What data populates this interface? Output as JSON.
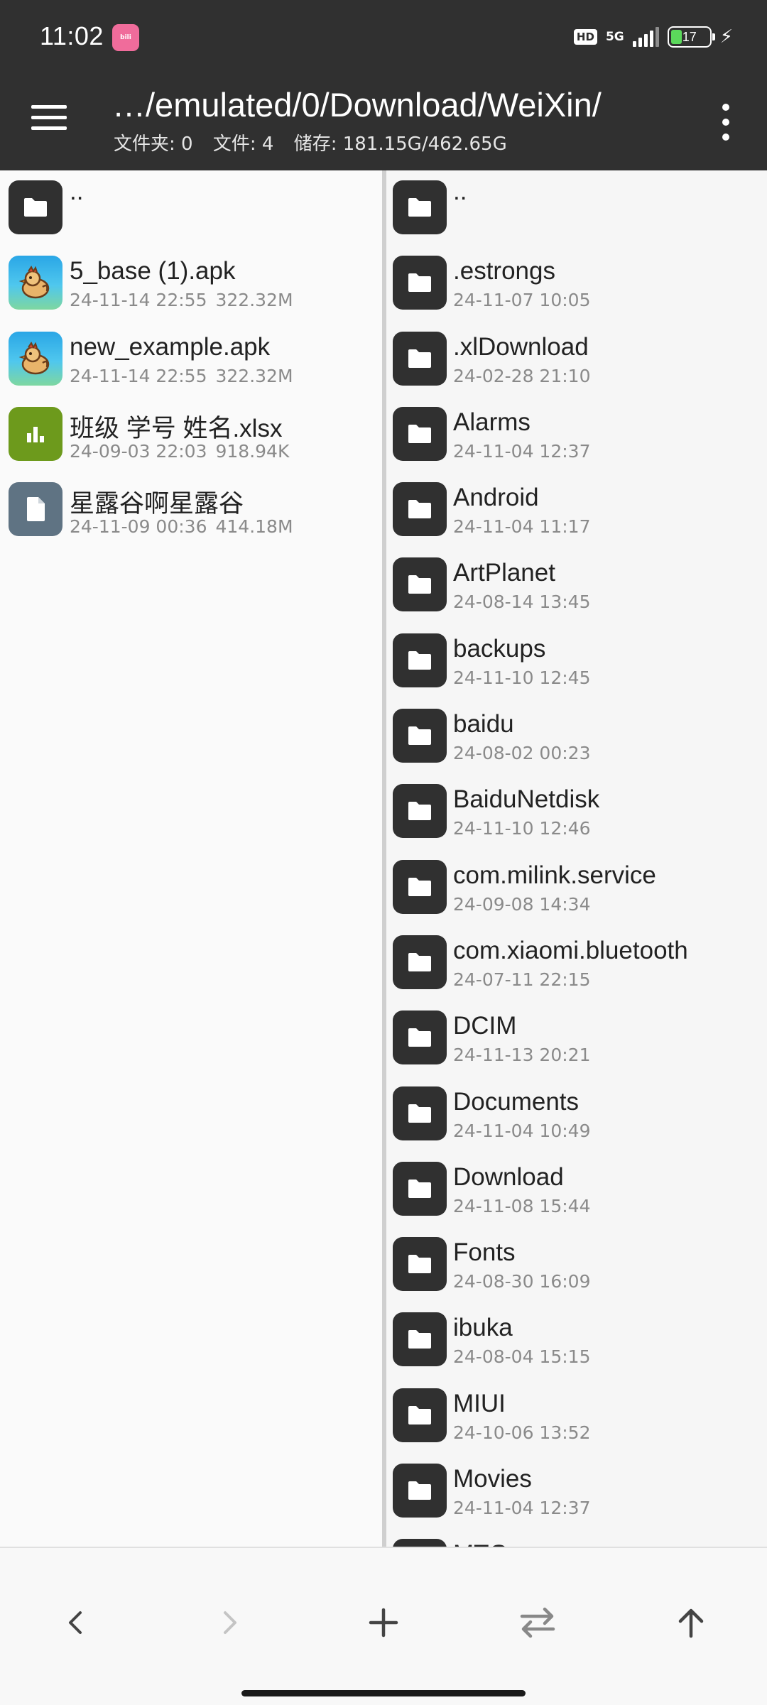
{
  "status_bar": {
    "time": "11:02",
    "notification_app": "bilibili",
    "hd_badge": "HD",
    "network": "5G",
    "battery_level": "17",
    "charging": true
  },
  "toolbar": {
    "path": "…/emulated/0/Download/WeiXin/",
    "folders_label": "文件夹: 0",
    "files_label": "文件: 4",
    "storage_label": "储存: 181.15G/462.65G"
  },
  "left_pane": {
    "items": [
      {
        "name": "..",
        "date": "",
        "size": "",
        "icon": "folder-icon"
      },
      {
        "name": "5_base (1).apk",
        "date": "24-11-14 22:55",
        "size": "322.32M",
        "icon": "apk-icon"
      },
      {
        "name": "new_example.apk",
        "date": "24-11-14 22:55",
        "size": "322.32M",
        "icon": "apk-icon"
      },
      {
        "name": "班级 学号 姓名.xlsx",
        "date": "24-09-03 22:03",
        "size": "918.94K",
        "icon": "spreadsheet-icon"
      },
      {
        "name": "星露谷啊星露谷",
        "date": "24-11-09 00:36",
        "size": "414.18M",
        "icon": "file-icon"
      }
    ]
  },
  "right_pane": {
    "items": [
      {
        "name": "..",
        "date": ""
      },
      {
        "name": ".estrongs",
        "date": "24-11-07 10:05"
      },
      {
        "name": ".xlDownload",
        "date": "24-02-28 21:10"
      },
      {
        "name": "Alarms",
        "date": "24-11-04 12:37"
      },
      {
        "name": "Android",
        "date": "24-11-04 11:17"
      },
      {
        "name": "ArtPlanet",
        "date": "24-08-14 13:45"
      },
      {
        "name": "backups",
        "date": "24-11-10 12:45"
      },
      {
        "name": "baidu",
        "date": "24-08-02 00:23"
      },
      {
        "name": "BaiduNetdisk",
        "date": "24-11-10 12:46"
      },
      {
        "name": "com.milink.service",
        "date": "24-09-08 14:34"
      },
      {
        "name": "com.xiaomi.bluetooth",
        "date": "24-07-11 22:15"
      },
      {
        "name": "DCIM",
        "date": "24-11-13 20:21"
      },
      {
        "name": "Documents",
        "date": "24-11-04 10:49"
      },
      {
        "name": "Download",
        "date": "24-11-08 15:44"
      },
      {
        "name": "Fonts",
        "date": "24-08-30 16:09"
      },
      {
        "name": "ibuka",
        "date": "24-08-04 15:15"
      },
      {
        "name": "MIUI",
        "date": "24-10-06 13:52"
      },
      {
        "name": "Movies",
        "date": "24-11-04 12:37"
      },
      {
        "name": "MTG",
        "date": ""
      }
    ]
  },
  "bottom_bar": {
    "buttons": [
      "back-icon",
      "forward-icon",
      "add-icon",
      "swap-icon",
      "up-icon"
    ]
  },
  "colors": {
    "header_bg": "#303030",
    "folder_icon_bg": "#303030",
    "xlsx_icon_bg": "#6d9a1c",
    "file_icon_bg": "#5f7383",
    "battery_fill": "#5bd85b"
  }
}
